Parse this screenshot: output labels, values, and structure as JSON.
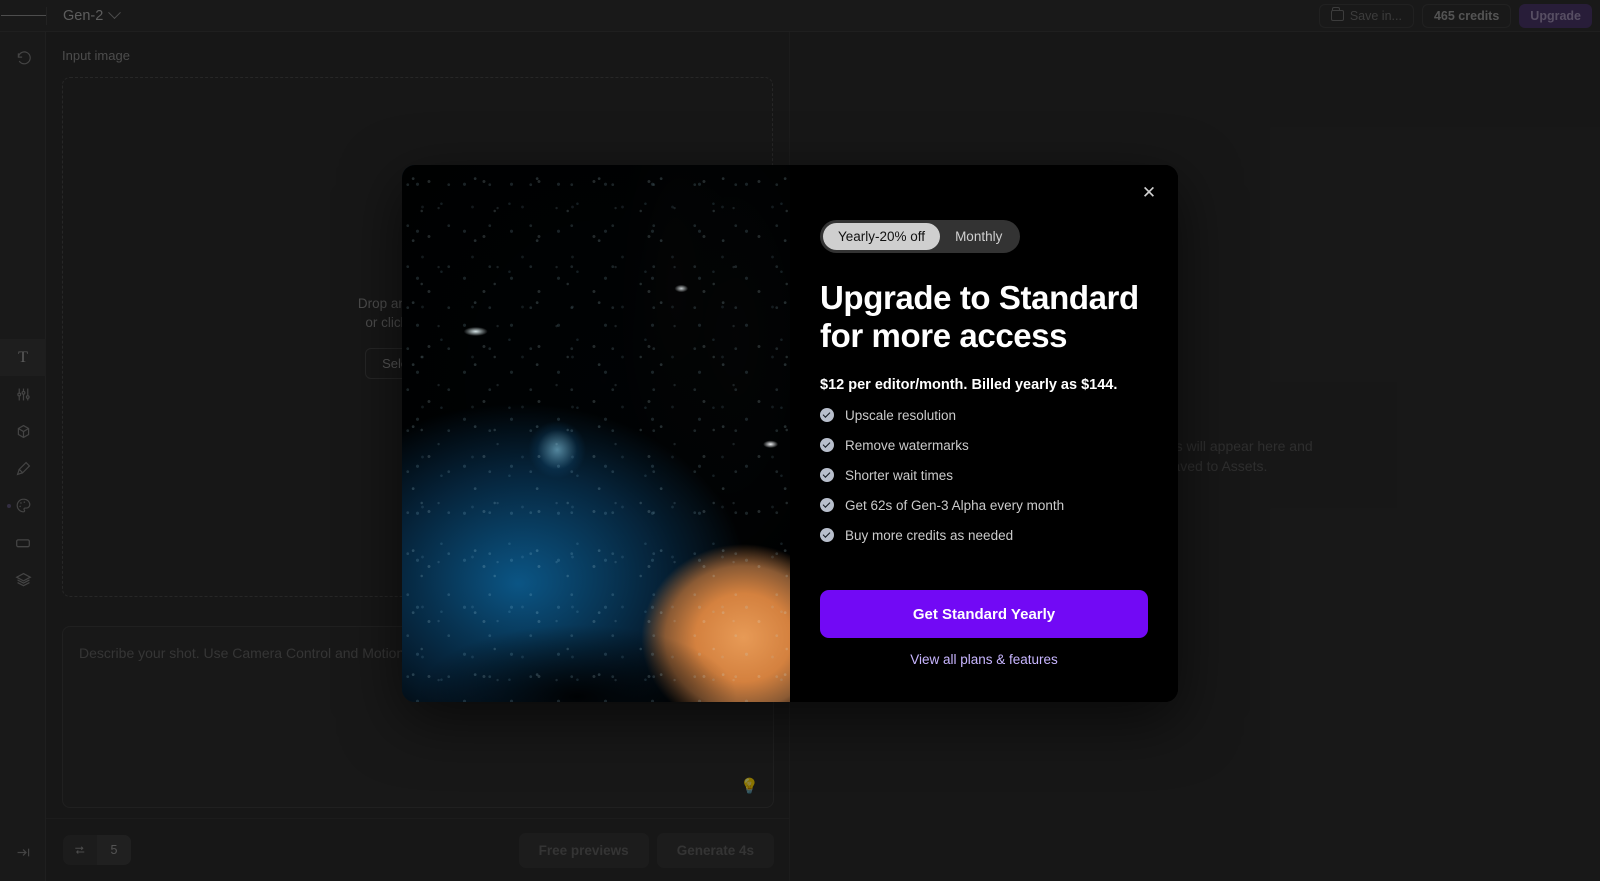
{
  "topbar": {
    "menu_icon": "hamburger-icon",
    "model": "Gen-2",
    "save_in": "Save in...",
    "credits": "465 credits",
    "upgrade": "Upgrade"
  },
  "rail": {
    "items": [
      {
        "icon": "history-icon",
        "name": "history"
      },
      {
        "icon": "text-icon",
        "name": "text",
        "active": true
      },
      {
        "icon": "sliders-icon",
        "name": "settings"
      },
      {
        "icon": "cube-icon",
        "name": "3d"
      },
      {
        "icon": "brush-icon",
        "name": "brush"
      },
      {
        "icon": "palette-icon",
        "name": "palette"
      },
      {
        "icon": "rectangle-icon",
        "name": "frame"
      },
      {
        "icon": "layers-icon",
        "name": "layers"
      }
    ],
    "expand": "expand-sidebar-icon"
  },
  "left_panel": {
    "label": "Input image",
    "drop_line_1": "Drop an image here",
    "drop_line_2": "or click to browse",
    "select_button": "Select asset",
    "prompt_placeholder": "Describe your shot. Use Camera Control and Motion Brush for more direction.",
    "bulb_icon": "lightbulb-icon",
    "motion_icon": "motion-icon",
    "motion_value": "5",
    "free_previews": "Free previews",
    "generate": "Generate 4s"
  },
  "right_panel": {
    "line_1": "Your generations will appear here and",
    "line_2": "will be saved to Assets."
  },
  "modal": {
    "close_icon": "close-icon",
    "billing_options": [
      "Yearly-20% off",
      "Monthly"
    ],
    "billing_selected": "Yearly-20% off",
    "title": "Upgrade to Standard for more access",
    "title_line_1": "Upgrade to Standard",
    "title_line_2": "for more access",
    "price": "$12 per editor/month. Billed yearly as $144.",
    "features": [
      "Upscale resolution",
      "Remove watermarks",
      "Shorter wait times",
      "Get 62s of Gen-3 Alpha every month",
      "Buy more credits as needed"
    ],
    "cta": "Get Standard Yearly",
    "link": "View all plans & features",
    "artwork": "blue-planet-artwork"
  },
  "colors": {
    "accent_purple": "#7209f5",
    "upgrade_purple": "#4a3668",
    "app_bg": "#2b2b2b",
    "modal_bg": "#000000",
    "link": "#c8b6ff"
  }
}
